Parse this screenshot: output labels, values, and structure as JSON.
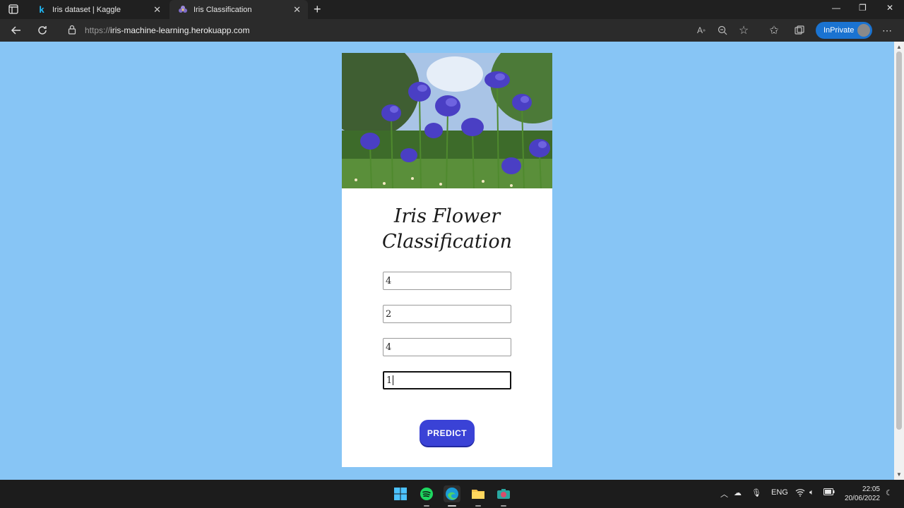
{
  "browser": {
    "tabs": [
      {
        "title": "Iris dataset | Kaggle",
        "favicon": "kaggle-k-icon"
      },
      {
        "title": "Iris Classification",
        "favicon": "iris-flower-icon"
      }
    ],
    "url_scheme": "https://",
    "url_host": "iris-machine-learning.herokuapp.com",
    "inprivate_label": "InPrivate"
  },
  "page": {
    "title_line1": "Iris Flower",
    "title_line2": "Classification",
    "fields": [
      {
        "value": "4"
      },
      {
        "value": "2"
      },
      {
        "value": "4"
      },
      {
        "value": "1"
      }
    ],
    "predict_label": "PREDICT"
  },
  "taskbar": {
    "language": "ENG",
    "time": "22:05",
    "date": "20/06/2022"
  },
  "colors": {
    "page_background": "#87c5f5",
    "predict_button": "#3a42d6",
    "inprivate_badge": "#1a73d1"
  }
}
